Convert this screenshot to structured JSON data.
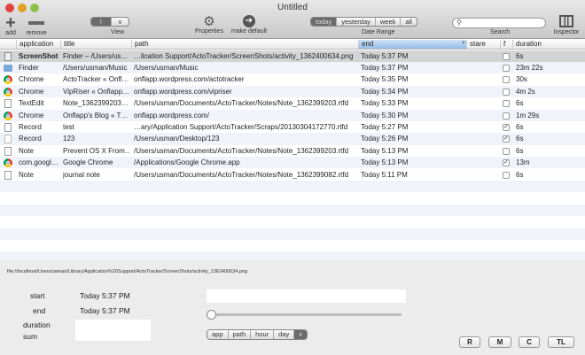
{
  "window": {
    "title": "Untitled"
  },
  "toolbar": {
    "add": "add",
    "remove": "remove",
    "view_label": "View",
    "view_options": [
      "l",
      "v"
    ],
    "properties": "Properties",
    "make_default": "make default",
    "date_range_label": "Date Range",
    "date_options": [
      "today",
      "yesterday",
      "week",
      "all"
    ],
    "search_label": "Search",
    "search_value": "",
    "inspector": "Inspector"
  },
  "table": {
    "columns": [
      "application",
      "title",
      "path",
      "end",
      "stare",
      "f",
      "duration"
    ],
    "rows": [
      {
        "icon": "screenshot",
        "app": "ScreenShot",
        "title": "Finder – /Users/us…",
        "path": "…lication Support/ActoTracker/ScreenShots/activity_1362400634.png",
        "end": "Today 5:37 PM",
        "f": false,
        "duration": "6s"
      },
      {
        "icon": "folder",
        "app": "Finder",
        "title": "/Users/usman/Music",
        "path": "/Users/usman/Music",
        "end": "Today 5:37 PM",
        "f": false,
        "duration": "23m 22s"
      },
      {
        "icon": "chrome",
        "app": "Chrome",
        "title": "ActoTracker « Onfl…",
        "path": "onflapp.wordpress.com/actotracker",
        "end": "Today 5:35 PM",
        "f": false,
        "duration": "30s"
      },
      {
        "icon": "chrome",
        "app": "Chrome",
        "title": "VipRiser « Onflapp…",
        "path": "onflapp.wordpress.com/vipriser",
        "end": "Today 5:34 PM",
        "f": false,
        "duration": "4m 2s"
      },
      {
        "icon": "document",
        "app": "TextEdit",
        "title": "Note_1362399203…",
        "path": "/Users/usman/Documents/ActoTracker/Notes/Note_1362399203.rtfd",
        "end": "Today 5:33 PM",
        "f": false,
        "duration": "6s"
      },
      {
        "icon": "chrome",
        "app": "Chrome",
        "title": "Onflapp's Blog « T…",
        "path": "onflapp.wordpress.com/",
        "end": "Today 5:30 PM",
        "f": false,
        "duration": "1m 29s"
      },
      {
        "icon": "document",
        "app": "Record",
        "title": "test",
        "path": "…ary/Application Support/ActoTracker/Scraps/20130304172770.rtfd",
        "end": "Today 5:27 PM",
        "f": true,
        "duration": "6s"
      },
      {
        "icon": "blank",
        "app": "Record",
        "title": "123",
        "path": "/Users/usman/Desktop/123",
        "end": "Today 5:26 PM",
        "f": true,
        "duration": "6s"
      },
      {
        "icon": "document",
        "app": "Note",
        "title": "Prevent OS X From…",
        "path": "/Users/usman/Documents/ActoTracker/Notes/Note_1362399203.rtfd",
        "end": "Today 5:13 PM",
        "f": false,
        "duration": "6s"
      },
      {
        "icon": "chrome",
        "app": "com.googl…",
        "title": "Google Chrome",
        "path": "/Applications/Google Chrome.app",
        "end": "Today 5:13 PM",
        "f": true,
        "duration": "13m"
      },
      {
        "icon": "document",
        "app": "Note",
        "title": "journal note",
        "path": "/Users/usman/Documents/ActoTracker/Notes/Note_1362399082.rtfd",
        "end": "Today 5:11 PM",
        "f": false,
        "duration": "6s"
      }
    ]
  },
  "detail": {
    "file_path": "file://localhost/Users/usman/Library/Application%20Support/ActoTracker/ScreenShots/activity_1362400634.png",
    "start_label": "start",
    "start_value": "Today 5:37 PM",
    "end_label": "end",
    "end_value": "Today 5:37 PM",
    "duration_label": "duration",
    "duration_value": "",
    "sum_label": "sum",
    "sum_value": "",
    "note_value": "",
    "slider_value": 0,
    "group_options": [
      "app",
      "path",
      "hour",
      "day",
      "x"
    ],
    "buttons": [
      "R",
      "M",
      "C",
      "TL"
    ]
  }
}
